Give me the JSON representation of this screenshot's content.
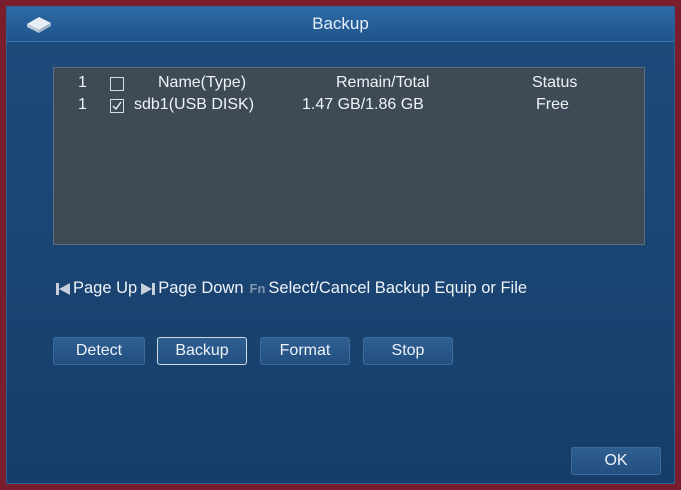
{
  "dialog": {
    "title": "Backup"
  },
  "table": {
    "header": {
      "index": "1",
      "name": "Name(Type)",
      "remain_total": "Remain/Total",
      "status": "Status"
    },
    "rows": [
      {
        "index": "1",
        "checked": true,
        "name": "sdb1(USB DISK)",
        "remain_total": "1.47 GB/1.86 GB",
        "status": "Free"
      }
    ]
  },
  "hint": {
    "page_up": "Page Up",
    "page_down": "Page Down",
    "fn_icon": "Fn",
    "select_text": "Select/Cancel Backup Equip or File"
  },
  "buttons": {
    "detect": "Detect",
    "backup": "Backup",
    "format": "Format",
    "stop": "Stop",
    "ok": "OK"
  },
  "icons": {
    "title_logo": "disk-logo-icon",
    "page_up": "skip-back-icon",
    "page_down": "skip-forward-icon"
  }
}
